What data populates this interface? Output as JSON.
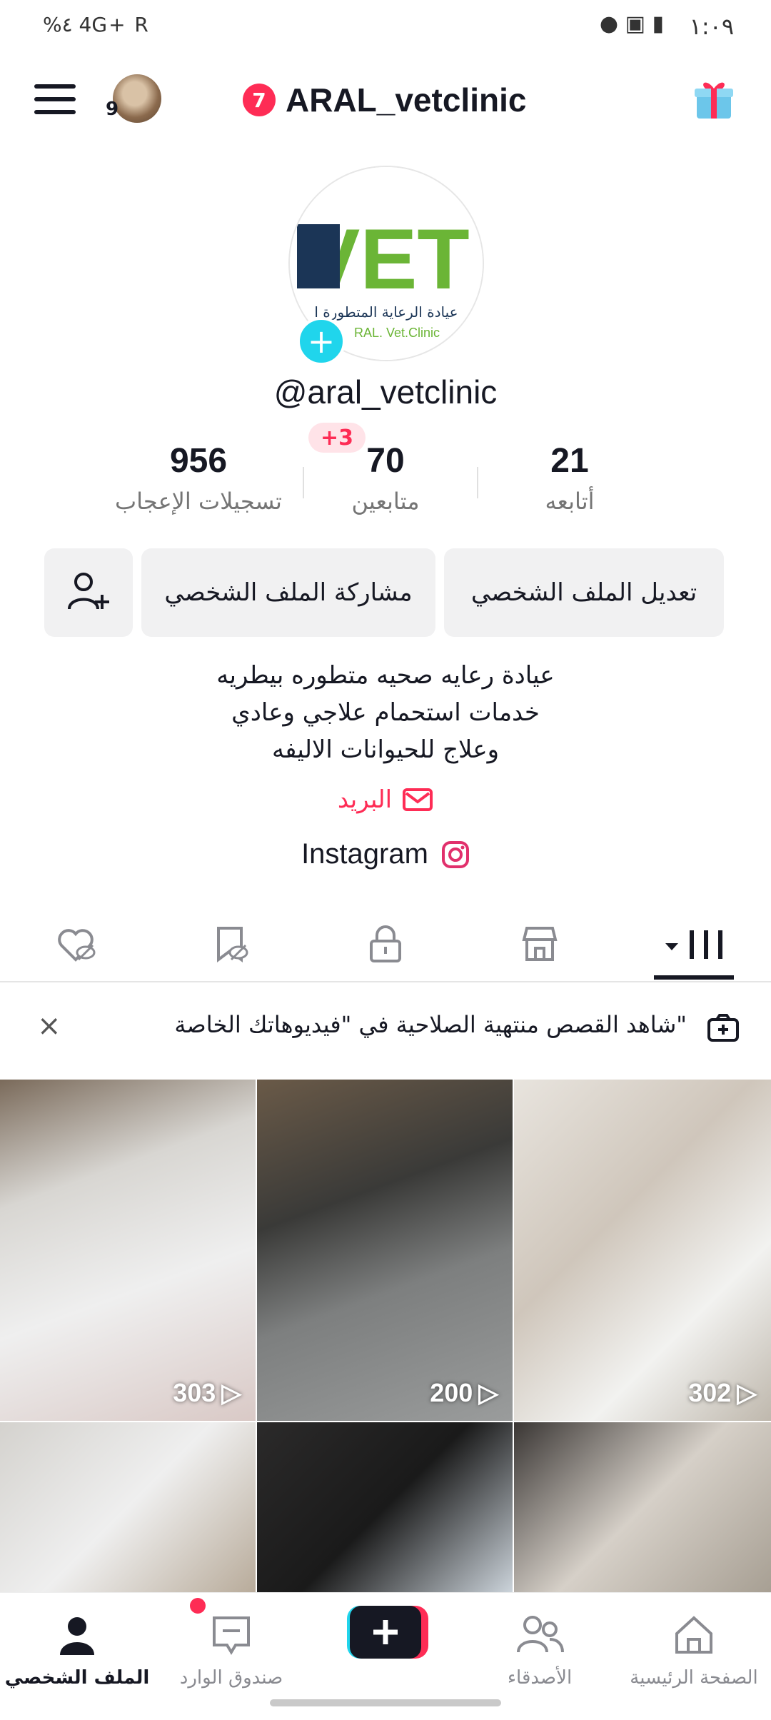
{
  "status_bar": {
    "time": "١:٠٩",
    "left_indicators": "%٤ 4G+ R",
    "right_icons": "alarm, silent, image, alert"
  },
  "header": {
    "notification_count": "7",
    "title": "ARAL_vetclinic",
    "avatar_badge": "9"
  },
  "profile": {
    "logo_text": "VET",
    "logo_arabic": "عيادة الرعاية المتطورة ا",
    "logo_english": "RAL. Vet.Clinic",
    "handle": "@aral_vetclinic",
    "new_followers_badge": "+3"
  },
  "stats": [
    {
      "value": "21",
      "label": "أتابعه"
    },
    {
      "value": "70",
      "label": "متابعين"
    },
    {
      "value": "956",
      "label": "تسجيلات الإعجاب"
    }
  ],
  "actions": {
    "edit_profile": "تعديل الملف الشخصي",
    "share_profile": "مشاركة الملف الشخصي"
  },
  "bio": {
    "lines": [
      "عيادة رعايه صحيه متطوره بيطريه",
      "خدمات استحمام علاجي وعادي",
      "وعلاج للحيوانات الاليفه"
    ]
  },
  "email_label": "البريد",
  "instagram_label": "Instagram",
  "tabs": [
    "videos",
    "shop",
    "private",
    "favorites",
    "liked"
  ],
  "banner": {
    "text": "شاهد القصص منتهية الصلاحية في \"فيديوهاتك الخاصة\""
  },
  "videos": [
    {
      "views": "302"
    },
    {
      "views": "200"
    },
    {
      "views": "303"
    },
    {
      "views": ""
    },
    {
      "views": ""
    },
    {
      "views": ""
    }
  ],
  "bottom_nav": {
    "home": "الصفحة الرئيسية",
    "friends": "الأصدقاء",
    "inbox": "صندوق الوارد",
    "profile": "الملف الشخصي"
  },
  "colors": {
    "accent": "#fe2c55",
    "cyan": "#20d5ec",
    "logo_green": "#6bb536",
    "logo_navy": "#1b3556"
  }
}
